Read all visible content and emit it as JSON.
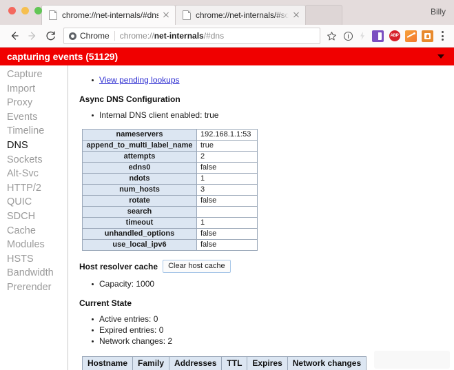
{
  "window": {
    "profile_name": "Billy",
    "traffic_lights": [
      "close",
      "minimize",
      "maximize"
    ]
  },
  "tabs": [
    {
      "title": "chrome://net-internals/#dns",
      "active": true,
      "close_label": "×"
    },
    {
      "title": "chrome://net-internals/#socke",
      "active": false,
      "close_label": "×"
    }
  ],
  "toolbar": {
    "back_label": "Back",
    "forward_label": "Forward",
    "reload_label": "Reload",
    "security_chip_label": "Chrome",
    "url_prefix": "chrome://",
    "url_bold": "net-internals",
    "url_suffix": "/#dns",
    "star_label": "Bookmark this page",
    "info_label": "Page info",
    "extensions": [
      {
        "name": "office-extension-icon",
        "label": ""
      },
      {
        "name": "adblock-plus-icon",
        "label": "ABP"
      },
      {
        "name": "chart-extension-icon",
        "label": ""
      },
      {
        "name": "lastpass-icon",
        "label": ""
      }
    ],
    "menu_label": "Customize and control Google Chrome"
  },
  "capture_banner": {
    "text": "capturing events (51129)",
    "color": "#f00000",
    "caret": "▼"
  },
  "sidebar": {
    "items": [
      {
        "label": "Capture",
        "selected": false
      },
      {
        "label": "Import",
        "selected": false
      },
      {
        "label": "Proxy",
        "selected": false
      },
      {
        "label": "Events",
        "selected": false
      },
      {
        "label": "Timeline",
        "selected": false
      },
      {
        "label": "DNS",
        "selected": true
      },
      {
        "label": "Sockets",
        "selected": false
      },
      {
        "label": "Alt-Svc",
        "selected": false
      },
      {
        "label": "HTTP/2",
        "selected": false
      },
      {
        "label": "QUIC",
        "selected": false
      },
      {
        "label": "SDCH",
        "selected": false
      },
      {
        "label": "Cache",
        "selected": false
      },
      {
        "label": "Modules",
        "selected": false
      },
      {
        "label": "HSTS",
        "selected": false
      },
      {
        "label": "Bandwidth",
        "selected": false
      },
      {
        "label": "Prerender",
        "selected": false
      }
    ]
  },
  "content": {
    "pending_lookups_link": "View pending lookups",
    "async_dns_heading": "Async DNS Configuration",
    "internal_dns_client": "Internal DNS client enabled: true",
    "config_table": {
      "rows": [
        {
          "key": "nameservers",
          "value": "192.168.1.1:53"
        },
        {
          "key": "append_to_multi_label_name",
          "value": "true"
        },
        {
          "key": "attempts",
          "value": "2"
        },
        {
          "key": "edns0",
          "value": "false"
        },
        {
          "key": "ndots",
          "value": "1"
        },
        {
          "key": "num_hosts",
          "value": "3"
        },
        {
          "key": "rotate",
          "value": "false"
        },
        {
          "key": "search",
          "value": ""
        },
        {
          "key": "timeout",
          "value": "1"
        },
        {
          "key": "unhandled_options",
          "value": "false"
        },
        {
          "key": "use_local_ipv6",
          "value": "false"
        }
      ]
    },
    "host_resolver_heading": "Host resolver cache",
    "clear_host_cache_button": "Clear host cache",
    "capacity": "Capacity: 1000",
    "current_state_heading": "Current State",
    "state_items": [
      "Active entries: 0",
      "Expired entries: 0",
      "Network changes: 2"
    ],
    "cache_table_headers": [
      "Hostname",
      "Family",
      "Addresses",
      "TTL",
      "Expires",
      "Network changes"
    ]
  }
}
